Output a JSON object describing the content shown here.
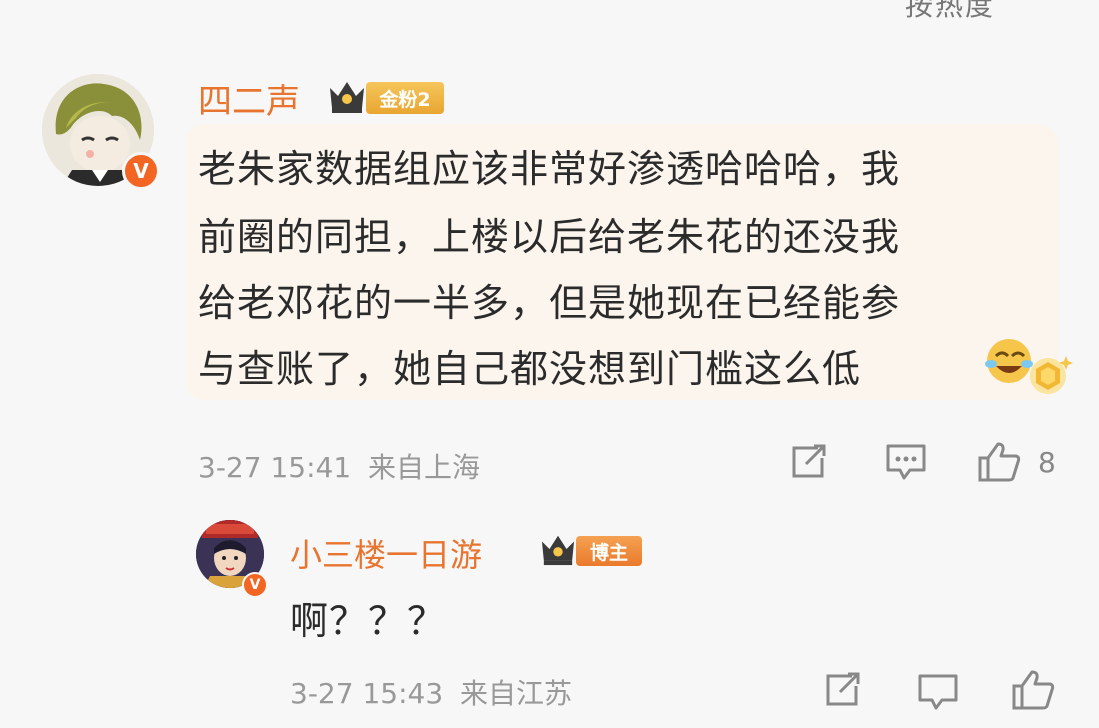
{
  "header": {
    "sort_label": "按热度"
  },
  "comments": [
    {
      "username": "四二声",
      "fan_tag": "金粉2",
      "lines": [
        "老朱家数据组应该非常好渗透哈哈哈，我",
        "前圈的同担，上楼以后给老朱花的还没我",
        "给老邓花的一半多，但是她现在已经能参",
        "与查账了，她自己都没想到门槛这么低"
      ],
      "emoji": "laughing-crying-emoji",
      "timestamp": "3-27 15:41",
      "location": "来自上海",
      "like_count": "8"
    },
    {
      "username": "小三楼一日游",
      "fan_tag": "博主",
      "text": "啊？？？",
      "timestamp": "3-27 15:43",
      "location": "来自江苏"
    }
  ],
  "colors": {
    "username": "#e8752f",
    "verified_badge": "#f26522",
    "fan_tag_gold": "#f0b53c",
    "blogger_tag": "#f0883a"
  }
}
